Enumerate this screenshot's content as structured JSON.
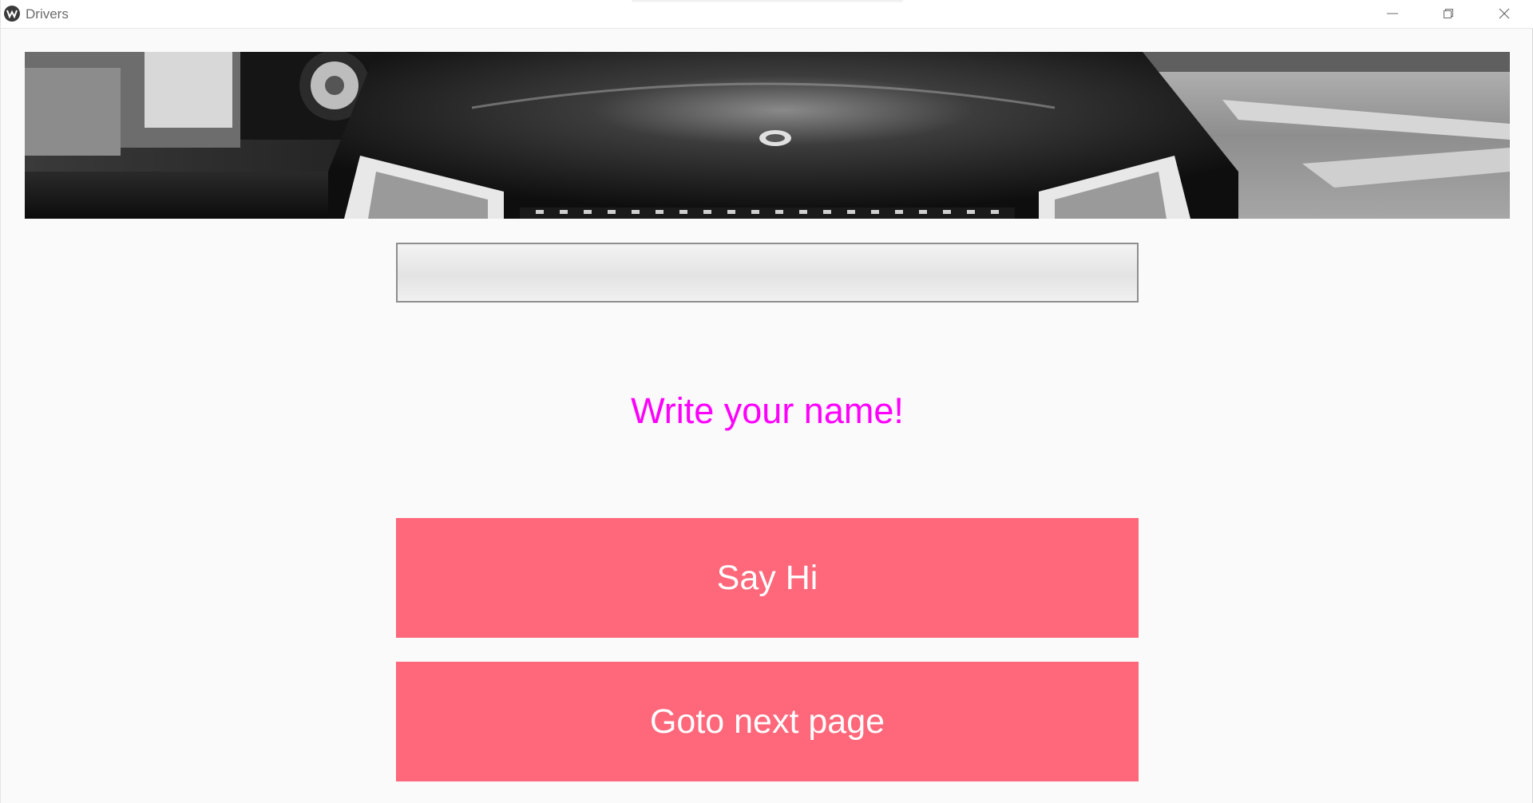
{
  "window": {
    "title": "Drivers",
    "controls": {
      "minimize_icon": "minimize-icon",
      "maximize_icon": "restore-icon",
      "close_icon": "close-icon"
    }
  },
  "banner": {
    "image_icon": "car-front-photo"
  },
  "name_input": {
    "value": "",
    "placeholder": ""
  },
  "prompt": {
    "text": "Write your name!",
    "color": "#ff00ff"
  },
  "buttons": {
    "say_hi": "Say Hi",
    "next_page": "Goto next page",
    "color": "#ff677a"
  }
}
